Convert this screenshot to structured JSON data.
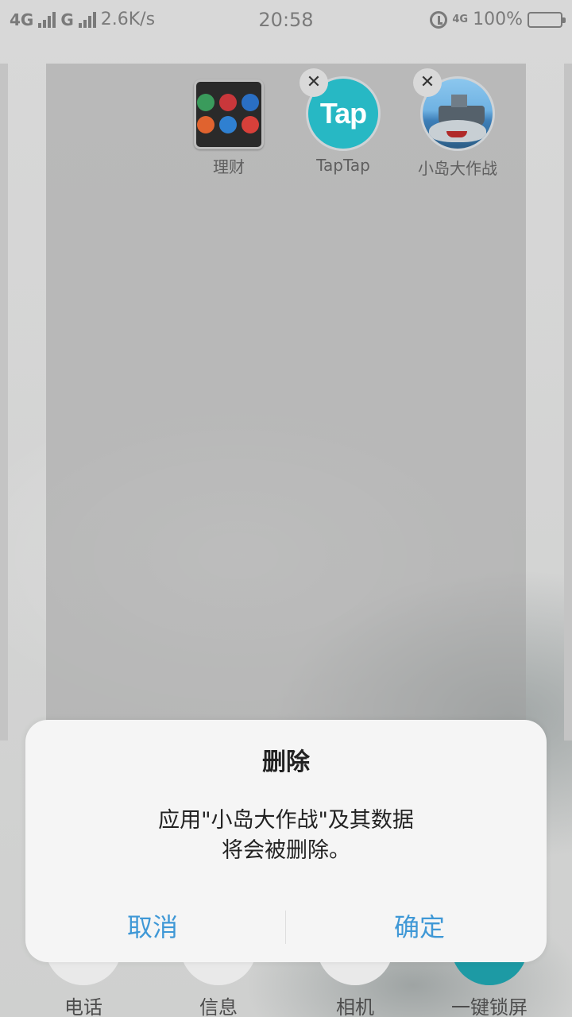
{
  "status_bar": {
    "net1": "4G",
    "net2": "G",
    "speed": "2.6K/s",
    "time": "20:58",
    "net_small": "4G",
    "battery_percent": "100%"
  },
  "home_edit": {
    "apps": [
      {
        "label": "理财",
        "icon": "folder-icon"
      },
      {
        "label": "TapTap",
        "icon": "taptap-icon",
        "icon_text": "Tap"
      },
      {
        "label": "小岛大作战",
        "icon": "island-game-icon"
      }
    ],
    "delete_badge_glyph": "✕"
  },
  "dock": [
    {
      "label": "电话"
    },
    {
      "label": "信息"
    },
    {
      "label": "相机"
    },
    {
      "label": "一键锁屏"
    }
  ],
  "dialog": {
    "title": "删除",
    "message_line1": "应用\"小岛大作战\"及其数据",
    "message_line2": "将会被删除。",
    "cancel": "取消",
    "confirm": "确定",
    "accent_color": "#3f98d6"
  }
}
